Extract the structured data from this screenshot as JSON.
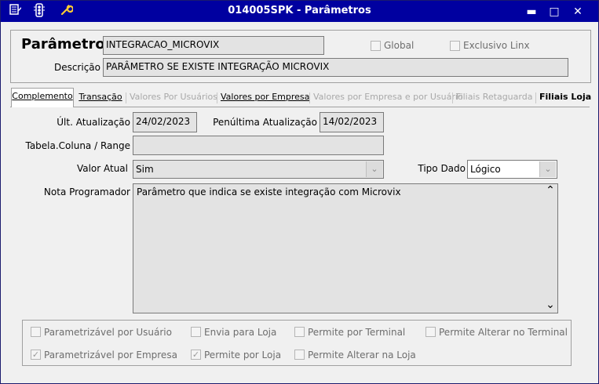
{
  "window": {
    "title": "014005SPK - Parâmetros",
    "minimize_glyph": "▬",
    "maximize_glyph": "□",
    "close_glyph": "✕"
  },
  "toolbar_icons": [
    "list-edit-icon",
    "traffic-light-icon",
    "wrench-icon"
  ],
  "header": {
    "param_label": "Parâmetro",
    "param_value": "INTEGRACAO_MICROVIX",
    "desc_label": "Descrição",
    "desc_value": "PARÂMETRO SE EXISTE INTEGRAÇÃO MICROVIX",
    "global_label": "Global",
    "exclusivo_label": "Exclusivo Linx"
  },
  "tabs": [
    {
      "label": "Complemento",
      "state": "active"
    },
    {
      "label": "Transação",
      "state": "normal"
    },
    {
      "label": "Valores Por Usuários",
      "state": "disabled"
    },
    {
      "label": "Valores por Empresa",
      "state": "normal"
    },
    {
      "label": "Valores por Empresa e por Usuário",
      "state": "disabled"
    },
    {
      "label": "Filiais Retaguarda",
      "state": "disabled"
    },
    {
      "label": "Filiais Loja",
      "state": "normal"
    }
  ],
  "complemento": {
    "ult_atualizacao_label": "Últ. Atualização",
    "ult_atualizacao_value": "24/02/2023",
    "penultima_label": "Penúltima Atualização",
    "penultima_value": "14/02/2023",
    "tabela_label": "Tabela.Coluna / Range",
    "tabela_value": "",
    "valor_atual_label": "Valor Atual",
    "valor_atual_value": "Sim",
    "tipo_dado_label": "Tipo Dado",
    "tipo_dado_value": "Lógico",
    "nota_label": "Nota Programador",
    "nota_value": "Parâmetro que indica se existe integração com Microvix",
    "scroll_up_glyph": "⌃",
    "scroll_down_glyph": "⌄",
    "dropdown_glyph": "⌄"
  },
  "checkboxes": [
    {
      "label": "Parametrizável por Usuário",
      "checked": false
    },
    {
      "label": "Envia para Loja",
      "checked": false
    },
    {
      "label": "Permite por Terminal",
      "checked": false
    },
    {
      "label": "Permite Alterar no Terminal",
      "checked": false
    },
    {
      "label": "Parametrizável por Empresa",
      "checked": true
    },
    {
      "label": "Permite por Loja",
      "checked": true
    },
    {
      "label": "Permite Alterar na Loja",
      "checked": false
    }
  ],
  "colors": {
    "titlebar": "#0000a0",
    "field_bg": "#e3e3e3",
    "window_bg": "#f0f0f0",
    "disabled_text": "#a8a8a8"
  }
}
